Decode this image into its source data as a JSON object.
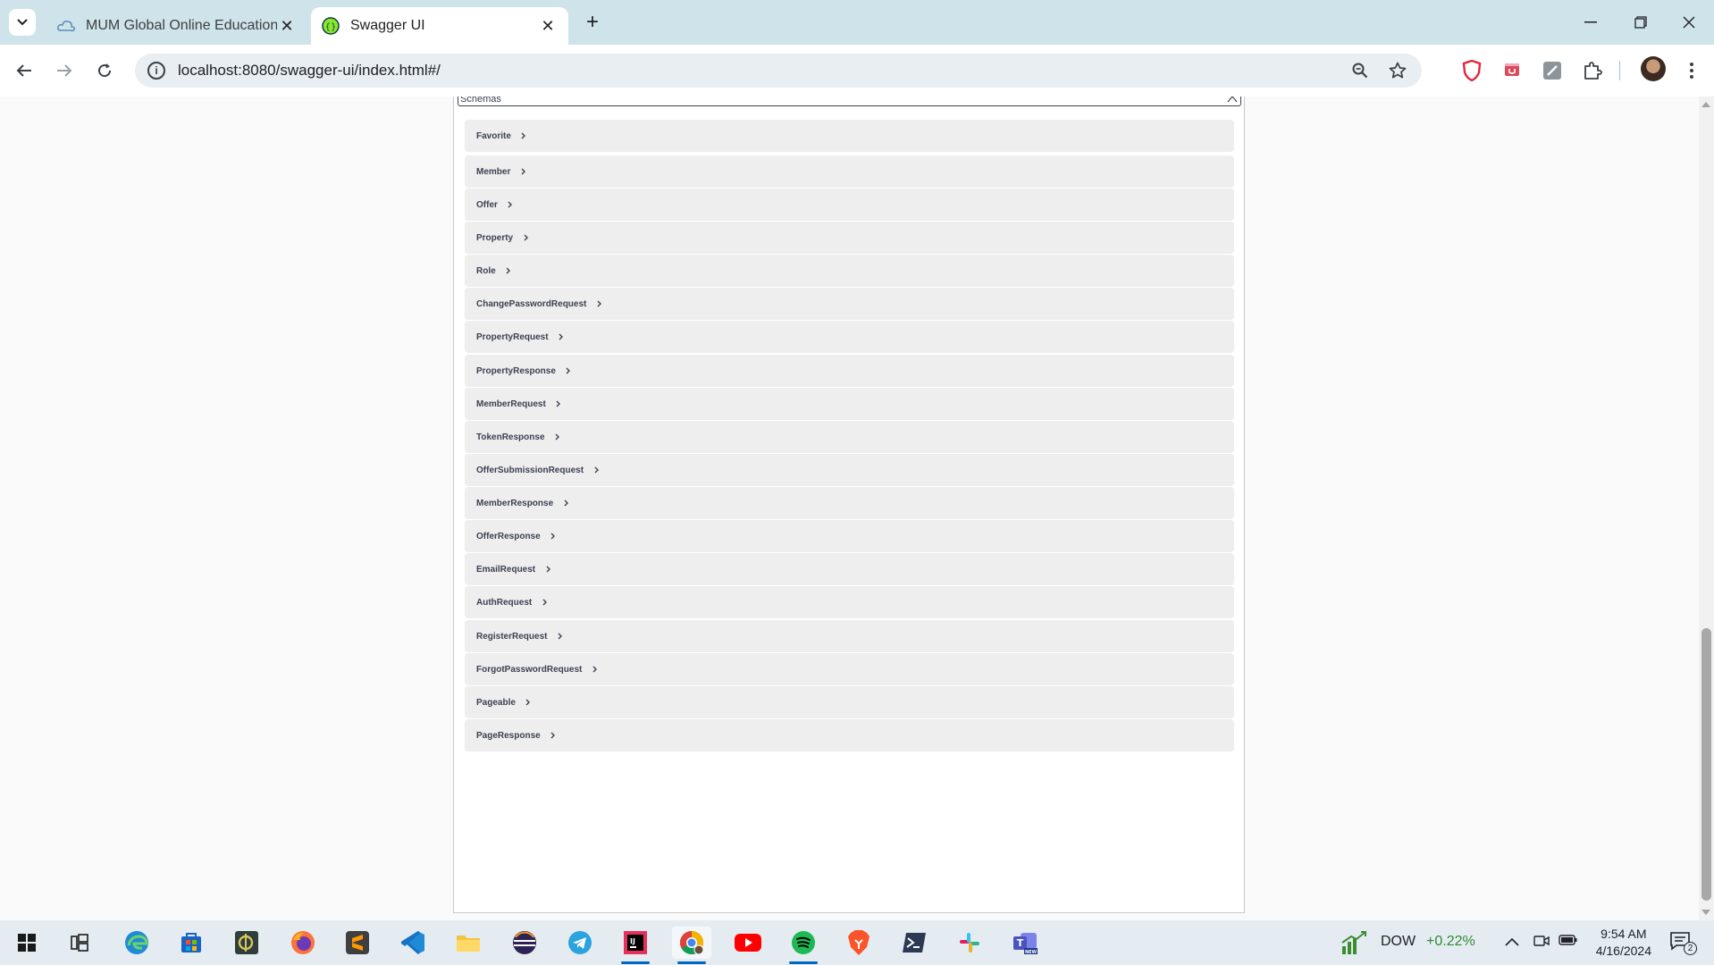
{
  "browser": {
    "tabs": [
      {
        "title": "MUM Global Online Education :",
        "active": false
      },
      {
        "title": "Swagger UI",
        "active": true
      }
    ],
    "url": "localhost:8080/swagger-ui/index.html#/"
  },
  "page": {
    "section_title": "Schemas",
    "schemas": [
      {
        "name": "Favorite"
      },
      {
        "name": "Member"
      },
      {
        "name": "Offer"
      },
      {
        "name": "Property"
      },
      {
        "name": "Role"
      },
      {
        "name": "ChangePasswordRequest"
      },
      {
        "name": "PropertyRequest"
      },
      {
        "name": "PropertyResponse"
      },
      {
        "name": "MemberRequest"
      },
      {
        "name": "TokenResponse"
      },
      {
        "name": "OfferSubmissionRequest"
      },
      {
        "name": "MemberResponse"
      },
      {
        "name": "OfferResponse"
      },
      {
        "name": "EmailRequest"
      },
      {
        "name": "AuthRequest"
      },
      {
        "name": "RegisterRequest"
      },
      {
        "name": "ForgotPasswordRequest"
      },
      {
        "name": "Pageable"
      },
      {
        "name": "PageResponse"
      }
    ]
  },
  "taskbar": {
    "ticker_name": "DOW",
    "ticker_change": "+0.22%",
    "time": "9:54 AM",
    "date": "4/16/2024",
    "notification_count": "2"
  },
  "colors": {
    "swagger_green": "#85ea2d",
    "brave_red": "#e0283f",
    "model_bg": "#eeeeee"
  }
}
